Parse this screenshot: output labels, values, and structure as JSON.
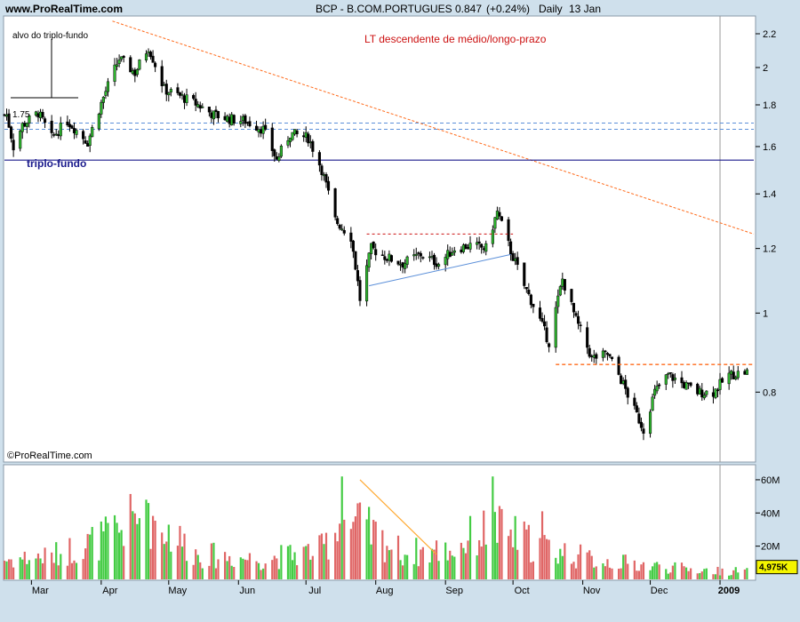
{
  "header": {
    "site": "www.ProRealTime.com",
    "instrument": "BCP - B.COM.PORTUGUES",
    "price": "0.847",
    "change": "(+0.24%)",
    "period": "Daily",
    "date": "13 Jan"
  },
  "watermark": "©ProRealTime.com",
  "colors": {
    "background": "#cfe0ec",
    "plot_bg": "#ffffff",
    "up_candle": "#2eb82e",
    "down_candle": "#000000",
    "volume_up": "#44cc44",
    "volume_down": "#e06666",
    "trendline": "#ff6a1a",
    "support": "#1a1a8c",
    "resistance_dashed": "#5b8fd9",
    "annotation_red": "#cc1111"
  },
  "chart_data": {
    "type": "candlestick",
    "price_axis": {
      "ticks": [
        0.8,
        1,
        1.2,
        1.4,
        1.6,
        1.8,
        2,
        2.2
      ],
      "labels": [
        "0.8",
        "1",
        "1.2",
        "1.4",
        "1.6",
        "1.8",
        "2",
        "2.2"
      ],
      "scale": "log",
      "range": [
        0.66,
        2.29
      ]
    },
    "volume_axis": {
      "ticks": [
        20,
        40,
        60
      ],
      "labels": [
        "20M",
        "40M",
        "60M"
      ],
      "range": [
        0,
        68
      ],
      "last_value_label": "4,975K"
    },
    "months": [
      "Mar",
      "Apr",
      "May",
      "Jun",
      "Jul",
      "Aug",
      "Sep",
      "Oct",
      "Nov",
      "Dec",
      "2009"
    ],
    "annotations": {
      "lt_label": "LT descendente de médio/longo-prazo",
      "target_label": "alvo do triplo-fundo",
      "support_label": "triplo-fundo",
      "support_level": 1.54,
      "resistance_levels": [
        1.71,
        1.68
      ],
      "breakout_level": 0.865,
      "range_top": 1.25,
      "small_level_label": "1.75"
    },
    "price_anchors": [
      [
        "2008-02-19",
        1.75
      ],
      [
        "2008-02-22",
        1.6
      ],
      [
        "2008-02-26",
        1.7
      ],
      [
        "2008-03-04",
        1.76
      ],
      [
        "2008-03-10",
        1.64
      ],
      [
        "2008-03-17",
        1.72
      ],
      [
        "2008-03-26",
        1.62
      ],
      [
        "2008-04-03",
        1.87
      ],
      [
        "2008-04-09",
        2.05
      ],
      [
        "2008-04-16",
        1.97
      ],
      [
        "2008-04-22",
        2.12
      ],
      [
        "2008-04-29",
        1.88
      ],
      [
        "2008-05-07",
        1.84
      ],
      [
        "2008-05-14",
        1.8
      ],
      [
        "2008-05-21",
        1.75
      ],
      [
        "2008-05-28",
        1.73
      ],
      [
        "2008-06-04",
        1.72
      ],
      [
        "2008-06-12",
        1.68
      ],
      [
        "2008-06-18",
        1.54
      ],
      [
        "2008-06-24",
        1.66
      ],
      [
        "2008-07-02",
        1.64
      ],
      [
        "2008-07-08",
        1.5
      ],
      [
        "2008-07-14",
        1.3
      ],
      [
        "2008-07-21",
        1.24
      ],
      [
        "2008-07-25",
        1.04
      ],
      [
        "2008-07-30",
        1.2
      ],
      [
        "2008-08-06",
        1.17
      ],
      [
        "2008-08-13",
        1.15
      ],
      [
        "2008-08-21",
        1.18
      ],
      [
        "2008-08-29",
        1.15
      ],
      [
        "2008-09-05",
        1.2
      ],
      [
        "2008-09-12",
        1.21
      ],
      [
        "2008-09-19",
        1.2
      ],
      [
        "2008-09-24",
        1.33
      ],
      [
        "2008-09-30",
        1.19
      ],
      [
        "2008-10-06",
        1.08
      ],
      [
        "2008-10-13",
        0.98
      ],
      [
        "2008-10-17",
        0.92
      ],
      [
        "2008-10-23",
        1.1
      ],
      [
        "2008-10-29",
        0.98
      ],
      [
        "2008-11-05",
        0.88
      ],
      [
        "2008-11-12",
        0.89
      ],
      [
        "2008-11-17",
        0.84
      ],
      [
        "2008-11-24",
        0.76
      ],
      [
        "2008-11-28",
        0.72
      ],
      [
        "2008-12-03",
        0.8
      ],
      [
        "2008-12-09",
        0.84
      ],
      [
        "2008-12-15",
        0.82
      ],
      [
        "2008-12-22",
        0.8
      ],
      [
        "2008-12-29",
        0.8
      ],
      [
        "2009-01-05",
        0.84
      ],
      [
        "2009-01-13",
        0.847
      ]
    ],
    "volume_anchors": [
      [
        "2008-02-19",
        12
      ],
      [
        "2008-03-10",
        14
      ],
      [
        "2008-04-03",
        25
      ],
      [
        "2008-04-21",
        40
      ],
      [
        "2008-05-14",
        15
      ],
      [
        "2008-06-12",
        12
      ],
      [
        "2008-07-08",
        18
      ],
      [
        "2008-07-17",
        36
      ],
      [
        "2008-07-25",
        32
      ],
      [
        "2008-08-13",
        16
      ],
      [
        "2008-09-05",
        18
      ],
      [
        "2008-09-15",
        28
      ],
      [
        "2008-09-24",
        30
      ],
      [
        "2008-10-13",
        20
      ],
      [
        "2008-11-05",
        12
      ],
      [
        "2008-12-03",
        8
      ],
      [
        "2008-12-29",
        5
      ],
      [
        "2009-01-13",
        5
      ]
    ]
  }
}
